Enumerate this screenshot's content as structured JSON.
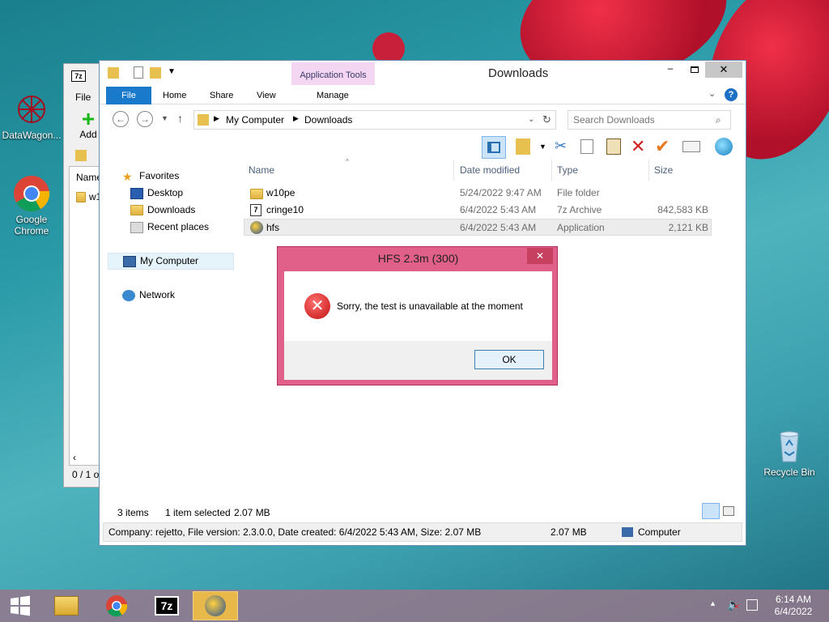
{
  "desktop": {
    "icons": [
      {
        "label": "DataWagon..."
      },
      {
        "label": "Google Chrome"
      },
      {
        "label": "Recycle Bin"
      }
    ]
  },
  "bg7z": {
    "title_icon": "7z",
    "menu_file": "File",
    "add_label": "Add",
    "col_name": "Name",
    "row1": "w1",
    "status": "0 / 1 o"
  },
  "explorer": {
    "title": "Downloads",
    "context_tab": "Application Tools",
    "tabs": [
      "File",
      "Home",
      "Share",
      "View",
      "Manage"
    ],
    "breadcrumb": [
      "My Computer",
      "Downloads"
    ],
    "search_placeholder": "Search Downloads",
    "nav": {
      "favorites": "Favorites",
      "desktop": "Desktop",
      "downloads": "Downloads",
      "recent": "Recent places",
      "computer": "My Computer",
      "network": "Network"
    },
    "columns": [
      "Name",
      "Date modified",
      "Type",
      "Size"
    ],
    "files": [
      {
        "name": "w10pe",
        "date": "5/24/2022 9:47 AM",
        "type": "File folder",
        "size": ""
      },
      {
        "name": "cringe10",
        "date": "6/4/2022 5:43 AM",
        "type": "7z Archive",
        "size": "842,583 KB"
      },
      {
        "name": "hfs",
        "date": "6/4/2022 5:43 AM",
        "type": "Application",
        "size": "2,121 KB"
      }
    ],
    "status_items": "3 items",
    "status_selected": "1 item selected",
    "status_size": "2.07 MB",
    "details": "Company: rejetto, File version: 2.3.0.0, Date created: 6/4/2022 5:43 AM, Size: 2.07 MB",
    "details_size": "2.07 MB",
    "details_location": "Computer"
  },
  "dialog": {
    "title": "HFS 2.3m (300)",
    "message": "Sorry, the test is unavailable at the moment",
    "ok": "OK"
  },
  "taskbar": {
    "time": "6:14 AM",
    "date": "6/4/2022"
  }
}
